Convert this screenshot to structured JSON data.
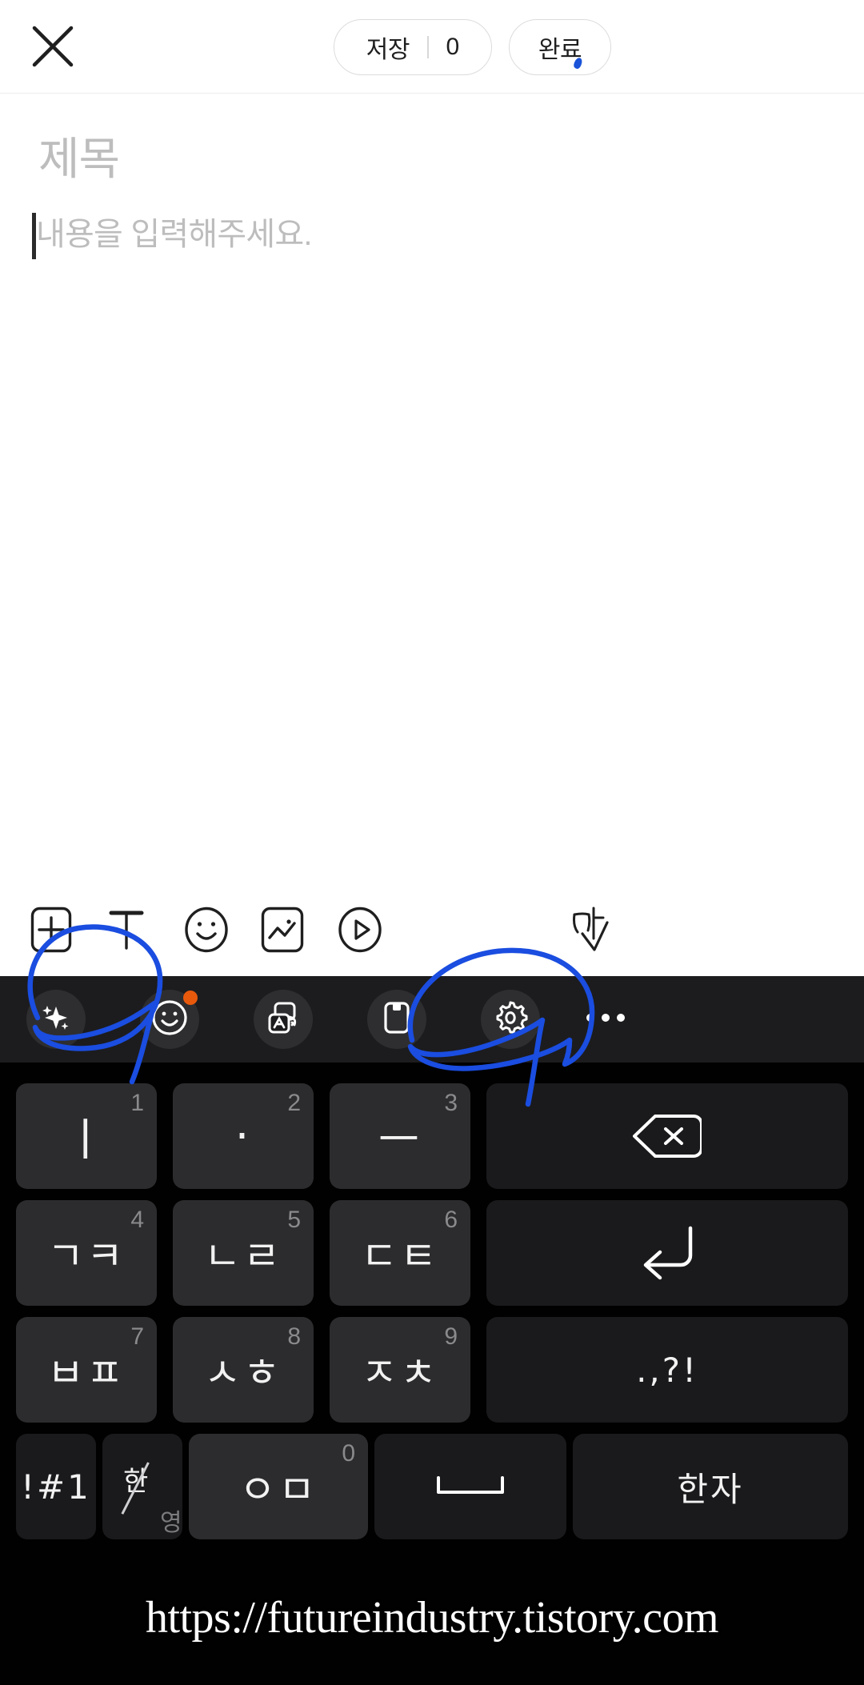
{
  "topbar": {
    "close_icon": "close-icon",
    "save_label": "저장",
    "save_count": "0",
    "done_label": "완료"
  },
  "editor": {
    "title_placeholder": "제목",
    "content_placeholder": "내용을 입력해주세요."
  },
  "editor_toolbar": {
    "items": [
      {
        "name": "add-block-button",
        "icon": "plus-box-icon"
      },
      {
        "name": "text-format-button",
        "icon": "text-t-icon"
      },
      {
        "name": "emoji-button",
        "icon": "smiley-icon"
      },
      {
        "name": "image-button",
        "icon": "image-icon"
      },
      {
        "name": "video-button",
        "icon": "play-circle-icon"
      },
      {
        "name": "keyboard-hide-button",
        "icon": "ga-down-arrow-icon"
      }
    ]
  },
  "keyboard_toolbar": {
    "items": [
      {
        "name": "ai-assist-button",
        "icon": "sparkle-icon",
        "badge": false
      },
      {
        "name": "emoji-sticker-button",
        "icon": "smiley-icon",
        "badge": true
      },
      {
        "name": "translate-button",
        "icon": "translate-icon",
        "badge": false
      },
      {
        "name": "clipboard-button",
        "icon": "clipboard-icon",
        "badge": false
      },
      {
        "name": "keyboard-settings-button",
        "icon": "gear-icon",
        "badge": false
      },
      {
        "name": "more-options-button",
        "icon": "ellipsis-icon",
        "badge": false
      }
    ],
    "badge_color": "#e8590c"
  },
  "keyboard": {
    "layout_name": "cheonjiin",
    "rows": [
      [
        {
          "name": "key-i",
          "glyph": "ㅣ",
          "num": "1",
          "type": "char"
        },
        {
          "name": "key-dot",
          "glyph": "·",
          "num": "2",
          "type": "char"
        },
        {
          "name": "key-eu",
          "glyph": "ㅡ",
          "num": "3",
          "type": "char"
        },
        {
          "name": "key-backspace",
          "glyph": "",
          "num": "",
          "type": "backspace"
        }
      ],
      [
        {
          "name": "key-giyeok-kieuk",
          "glyph": "ㄱㅋ",
          "num": "4",
          "type": "char"
        },
        {
          "name": "key-nieun-rieul",
          "glyph": "ㄴㄹ",
          "num": "5",
          "type": "char"
        },
        {
          "name": "key-digeut-tieut",
          "glyph": "ㄷㅌ",
          "num": "6",
          "type": "char"
        },
        {
          "name": "key-enter",
          "glyph": "",
          "num": "",
          "type": "enter"
        }
      ],
      [
        {
          "name": "key-bieup-pieup",
          "glyph": "ㅂㅍ",
          "num": "7",
          "type": "char"
        },
        {
          "name": "key-siot-hieut",
          "glyph": "ㅅㅎ",
          "num": "8",
          "type": "char"
        },
        {
          "name": "key-jieut-chieut",
          "glyph": "ㅈㅊ",
          "num": "9",
          "type": "char"
        },
        {
          "name": "key-punctuation",
          "glyph": ".,?!",
          "num": "",
          "type": "char"
        }
      ],
      [
        {
          "name": "key-symbols",
          "glyph": "!#1",
          "num": "",
          "type": "fn"
        },
        {
          "name": "key-han-eng",
          "glyph": "한/영",
          "num": "",
          "type": "hanyeong"
        },
        {
          "name": "key-ieung-mieum",
          "glyph": "ㅇㅁ",
          "num": "0",
          "type": "char"
        },
        {
          "name": "key-space",
          "glyph": "",
          "num": "",
          "type": "space"
        },
        {
          "name": "key-hanja",
          "glyph": "한자",
          "num": "",
          "type": "fn"
        }
      ]
    ]
  },
  "annotations": {
    "ink_color": "#1a4de0",
    "marks": [
      {
        "name": "ink-circle-ai-button",
        "target": "ai-assist-button"
      },
      {
        "name": "ink-circle-translate-button",
        "target": "translate-button"
      }
    ]
  },
  "watermark": {
    "text": "https://futureindustry.tistory.com"
  }
}
